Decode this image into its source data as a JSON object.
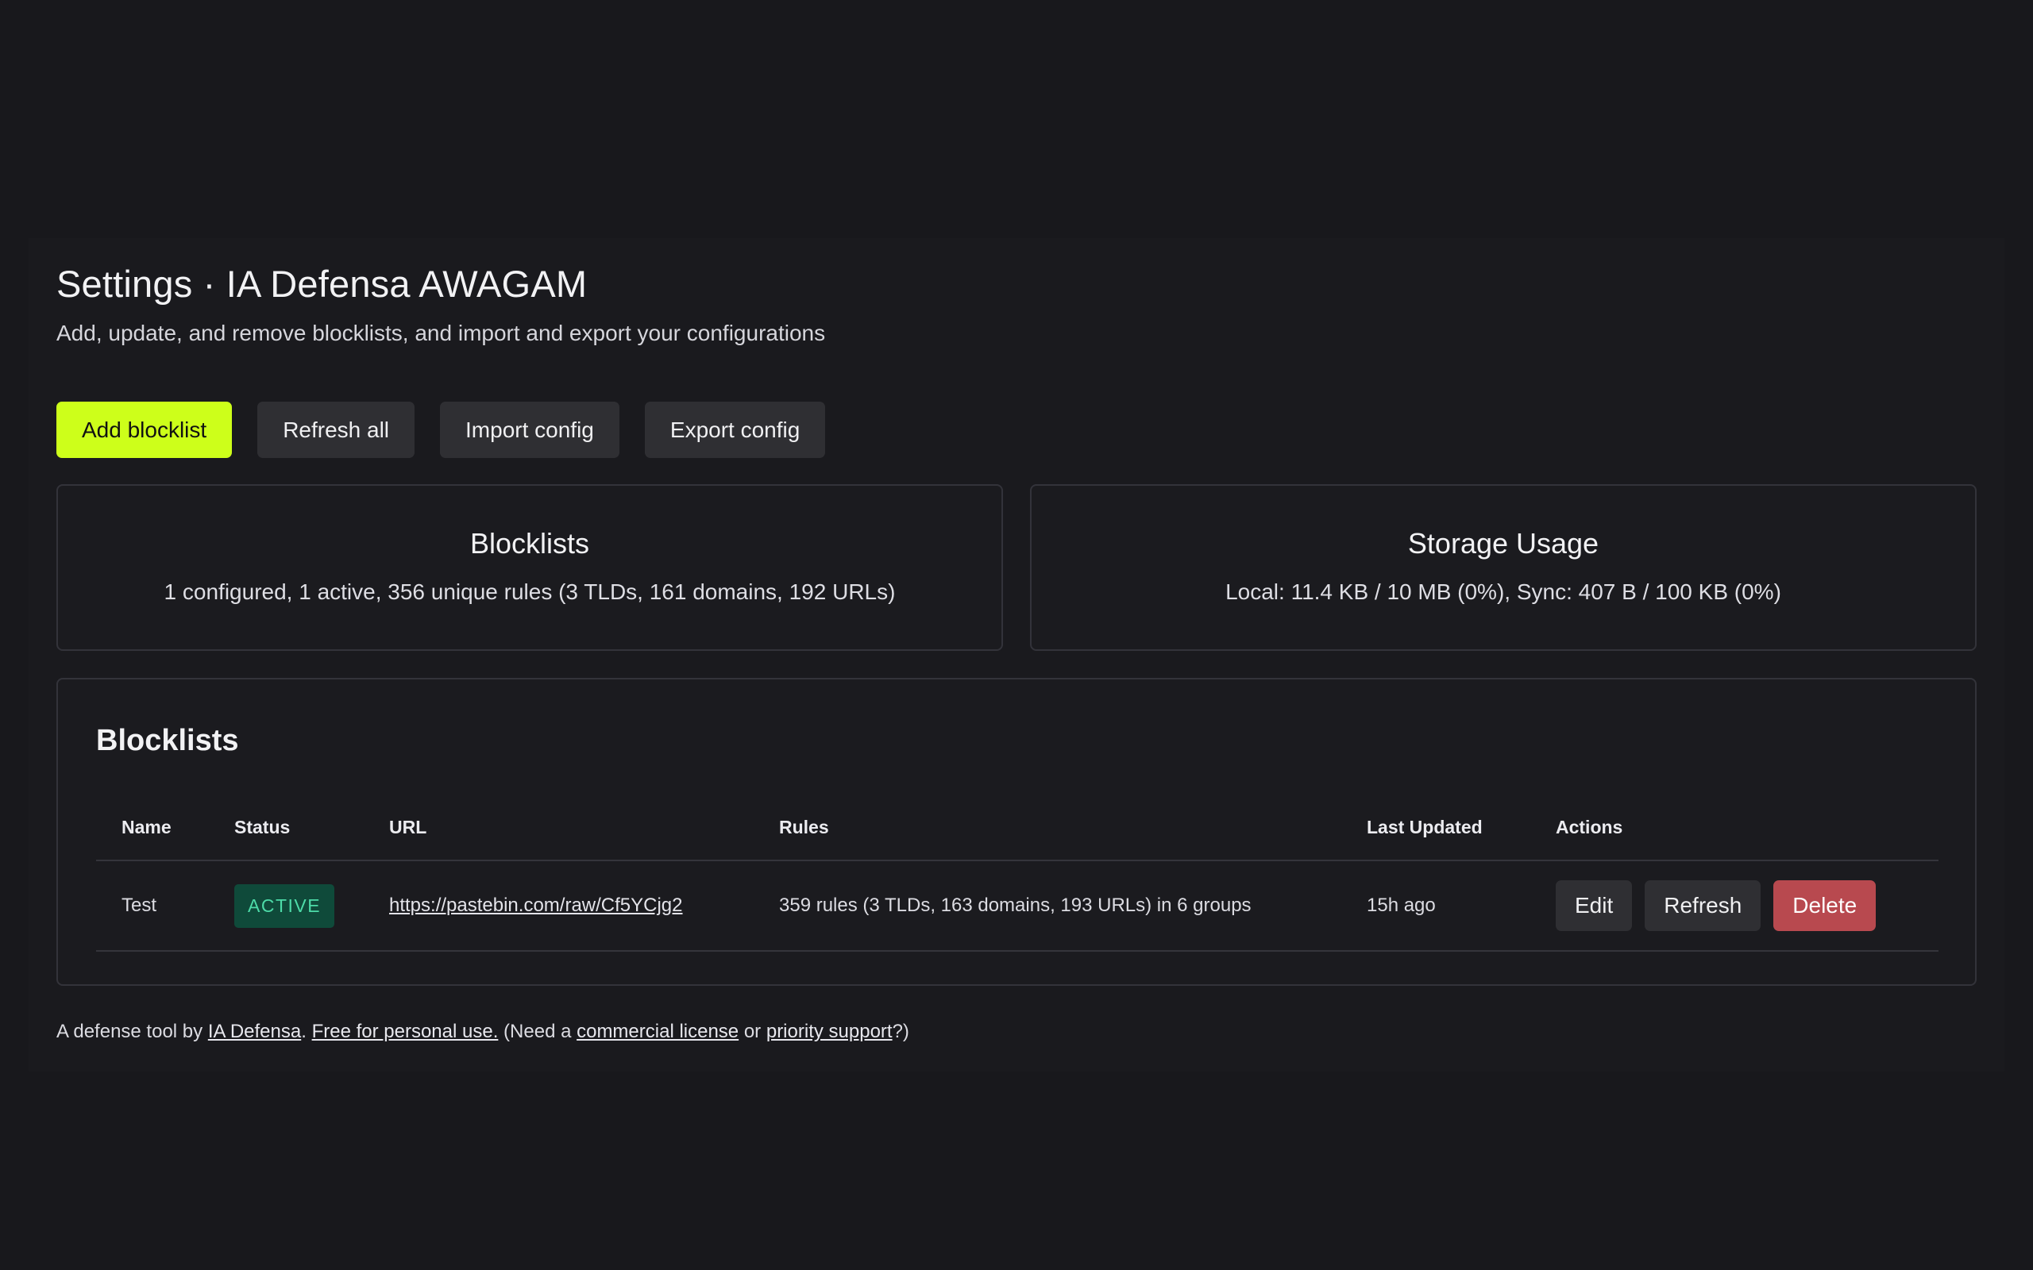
{
  "header": {
    "title": "Settings · IA Defensa AWAGAM",
    "subtitle": "Add, update, and remove blocklists, and import and export your configurations"
  },
  "toolbar": {
    "add_label": "Add blocklist",
    "refresh_all_label": "Refresh all",
    "import_label": "Import config",
    "export_label": "Export config"
  },
  "stats": {
    "blocklists": {
      "title": "Blocklists",
      "value": "1 configured, 1 active, 356 unique rules (3 TLDs, 161 domains, 192 URLs)"
    },
    "storage": {
      "title": "Storage Usage",
      "value": "Local: 11.4 KB / 10 MB (0%), Sync: 407 B / 100 KB (0%)"
    }
  },
  "blocklists": {
    "title": "Blocklists",
    "columns": {
      "name": "Name",
      "status": "Status",
      "url": "URL",
      "rules": "Rules",
      "last_updated": "Last Updated",
      "actions": "Actions"
    },
    "rows": [
      {
        "name": "Test",
        "status": "ACTIVE",
        "url": "https://pastebin.com/raw/Cf5YCjg2",
        "rules": "359 rules (3 TLDs, 163 domains, 193 URLs) in 6 groups",
        "last_updated": "15h ago",
        "edit_label": "Edit",
        "refresh_label": "Refresh",
        "delete_label": "Delete"
      }
    ]
  },
  "footer": {
    "prefix": "A defense tool by ",
    "brand_link": "IA Defensa",
    "sep": ". ",
    "free_link": "Free for personal use.",
    "need": " (Need a ",
    "commercial_link": "commercial license",
    "or": " or ",
    "support_link": "priority support",
    "suffix": "?)"
  },
  "colors": {
    "background": "#18181c",
    "primary_button": "#cdff1a",
    "secondary_button": "#2f2f33",
    "danger_button": "#b8494f",
    "active_badge_bg": "#0f4a3a",
    "active_badge_text": "#4ddba8"
  }
}
